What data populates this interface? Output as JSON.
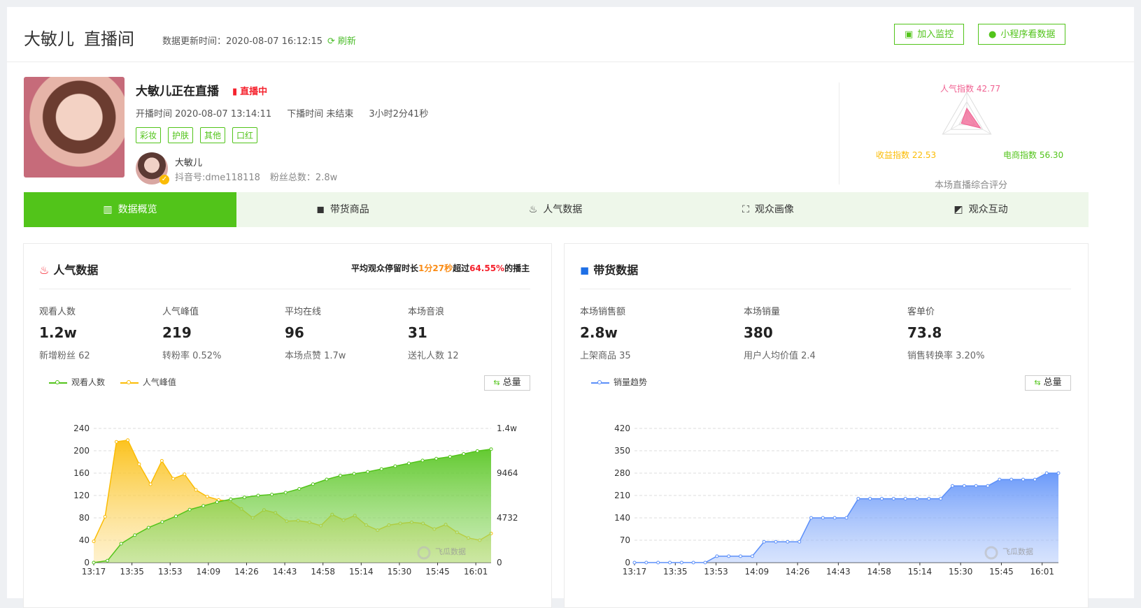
{
  "header": {
    "name": "大敏儿",
    "room": "直播间",
    "update_time": "数据更新时间：2020-08-07 16:12:15",
    "refresh": "刷新",
    "btn_monitor": "加入监控",
    "btn_miniapp": "小程序看数据"
  },
  "profile": {
    "live_title": "大敏儿正在直播",
    "live_status": "直播中",
    "start_time": "开播时间 2020-08-07 13:14:11",
    "end_time": "下播时间 未结束",
    "duration": "3小时2分41秒",
    "tags": [
      "彩妆",
      "护肤",
      "其他",
      "口红"
    ],
    "anchor_name": "大敏儿",
    "douyin_id": "抖音号:dme118118",
    "fans": "粉丝总数：2.8w"
  },
  "radar": {
    "popularity": "人气指数 42.77",
    "revenue": "收益指数 22.53",
    "ecommerce": "电商指数 56.30",
    "caption": "本场直播综合评分",
    "scores": {
      "popularity": 42.77,
      "revenue": 22.53,
      "ecommerce": 56.3
    },
    "colors": {
      "popularity": "#f06292",
      "revenue": "#fbbc05",
      "ecommerce": "#52c41a"
    }
  },
  "tabs": [
    {
      "label": "数据概览",
      "icon": "bar-chart-icon",
      "active": true
    },
    {
      "label": "带货商品",
      "icon": "shopping-bag-icon",
      "active": false
    },
    {
      "label": "人气数据",
      "icon": "flame-icon",
      "active": false
    },
    {
      "label": "观众画像",
      "icon": "portrait-icon",
      "active": false
    },
    {
      "label": "观众互动",
      "icon": "chat-icon",
      "active": false
    }
  ],
  "popularity_panel": {
    "title": "人气数据",
    "note_prefix": "平均观众停留时长",
    "note_duration": "1分27秒",
    "note_mid": "超过",
    "note_percent": "64.55%",
    "note_suffix": "的播主",
    "stats": [
      {
        "label": "观看人数",
        "value": "1.2w",
        "sub": "新增粉丝 62"
      },
      {
        "label": "人气峰值",
        "value": "219",
        "sub": "转粉率 0.52%"
      },
      {
        "label": "平均在线",
        "value": "96",
        "sub": "本场点赞 1.7w"
      },
      {
        "label": "本场音浪",
        "value": "31",
        "sub": "送礼人数 12"
      }
    ],
    "legend": [
      "观看人数",
      "人气峰值"
    ],
    "total_btn": "总量",
    "watermark": "飞瓜数据"
  },
  "sales_panel": {
    "title": "带货数据",
    "stats": [
      {
        "label": "本场销售额",
        "value": "2.8w",
        "sub": "上架商品 35"
      },
      {
        "label": "本场销量",
        "value": "380",
        "sub": "用户人均价值 2.4"
      },
      {
        "label": "客单价",
        "value": "73.8",
        "sub": "销售转换率 3.20%"
      }
    ],
    "legend": [
      "销量趋势"
    ],
    "total_btn": "总量",
    "watermark": "飞瓜数据"
  },
  "chart_data": [
    {
      "type": "area",
      "x": [
        "13:17",
        "13:35",
        "13:53",
        "14:09",
        "14:26",
        "14:43",
        "14:58",
        "15:14",
        "15:30",
        "15:45",
        "16:01"
      ],
      "series": [
        {
          "name": "观看人数",
          "axis": "right",
          "color": "#52c41a",
          "values": [
            0,
            200,
            2000,
            2900,
            3700,
            4300,
            4900,
            5600,
            6000,
            6400,
            6700,
            6900,
            7100,
            7200,
            7400,
            7800,
            8300,
            8800,
            9200,
            9400,
            9600,
            9900,
            10200,
            10500,
            10800,
            11000,
            11200,
            11500,
            11800,
            12000
          ]
        },
        {
          "name": "人气峰值",
          "axis": "left",
          "color": "#fbbc05",
          "values": [
            38,
            82,
            216,
            219,
            176,
            140,
            182,
            150,
            158,
            130,
            118,
            112,
            110,
            96,
            80,
            94,
            89,
            74,
            75,
            72,
            66,
            86,
            76,
            84,
            67,
            58,
            67,
            70,
            72,
            70,
            60,
            68,
            54,
            44,
            40,
            52
          ]
        }
      ],
      "ylim_left": [
        0,
        240
      ],
      "yticks_left": [
        0,
        40,
        80,
        120,
        160,
        200,
        240
      ],
      "ylim_right": [
        0,
        14196
      ],
      "yticks_right": [
        "0",
        "4732",
        "9464",
        "1.4w"
      ]
    },
    {
      "type": "area",
      "x": [
        "13:17",
        "13:35",
        "13:53",
        "14:09",
        "14:26",
        "14:43",
        "14:58",
        "15:14",
        "15:30",
        "15:45",
        "16:01"
      ],
      "series": [
        {
          "name": "销量趋势",
          "color": "#5b8ff9",
          "values": [
            0,
            0,
            0,
            0,
            0,
            0,
            0,
            20,
            20,
            20,
            20,
            65,
            65,
            65,
            65,
            140,
            140,
            140,
            140,
            200,
            200,
            200,
            200,
            200,
            200,
            200,
            200,
            240,
            240,
            240,
            240,
            260,
            260,
            260,
            260,
            280,
            280
          ]
        }
      ],
      "ylim": [
        0,
        420
      ],
      "yticks": [
        0,
        70,
        140,
        210,
        280,
        350,
        420
      ]
    }
  ]
}
